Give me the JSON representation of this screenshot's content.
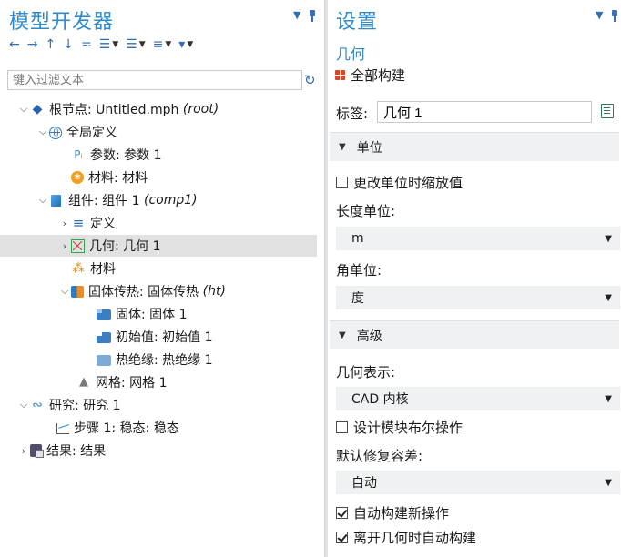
{
  "left": {
    "title": "模型开发器",
    "filter_placeholder": "键入过滤文本",
    "tree": [
      {
        "id": "root",
        "label": "根节点: Untitled.mph",
        "suffix": "(root)"
      },
      {
        "id": "global",
        "label": "全局定义",
        "suffix": ""
      },
      {
        "id": "params",
        "label": "参数: 参数 1",
        "suffix": ""
      },
      {
        "id": "materials_global",
        "label": "材料: 材料",
        "suffix": ""
      },
      {
        "id": "component",
        "label": "组件: 组件 1",
        "suffix": "(comp1)"
      },
      {
        "id": "definitions",
        "label": "定义",
        "suffix": ""
      },
      {
        "id": "geometry",
        "label": "几何: 几何 1",
        "suffix": ""
      },
      {
        "id": "materials",
        "label": "材料",
        "suffix": ""
      },
      {
        "id": "heat",
        "label": "固体传热: 固体传热",
        "suffix": "(ht)"
      },
      {
        "id": "solid",
        "label": "固体: 固体 1",
        "suffix": ""
      },
      {
        "id": "init",
        "label": "初始值: 初始值 1",
        "suffix": ""
      },
      {
        "id": "insulation",
        "label": "热绝缘: 热绝缘 1",
        "suffix": ""
      },
      {
        "id": "mesh",
        "label": "网格: 网格 1",
        "suffix": ""
      },
      {
        "id": "study",
        "label": "研究: 研究 1",
        "suffix": ""
      },
      {
        "id": "step",
        "label": "步骤 1: 稳态: 稳态",
        "suffix": ""
      },
      {
        "id": "results",
        "label": "结果: 结果",
        "suffix": ""
      }
    ]
  },
  "right": {
    "title": "设置",
    "subtitle": "几何",
    "build_all": "全部构建",
    "label_caption": "标签:",
    "label_value": "几何 1",
    "units_section": "单位",
    "scale_checkbox": "更改单位时缩放值",
    "length_unit_caption": "长度单位:",
    "length_unit_value": "m",
    "angle_unit_caption": "角单位:",
    "angle_unit_value": "度",
    "advanced_section": "高级",
    "geom_repr_caption": "几何表示:",
    "geom_repr_value": "CAD 内核",
    "boolean_checkbox": "设计模块布尔操作",
    "tolerance_caption": "默认修复容差:",
    "tolerance_value": "自动",
    "auto_build_new": "自动构建新操作",
    "auto_build_leave": "离开几何时自动构建"
  },
  "state": {
    "selected_node": "geometry",
    "scale_checked": false,
    "boolean_checked": false,
    "auto_build_new_checked": true,
    "auto_build_leave_checked": true
  },
  "colors": {
    "accent": "#2e8bc9",
    "selection": "#e1e1e1",
    "section_bg": "#f0f1f3"
  }
}
